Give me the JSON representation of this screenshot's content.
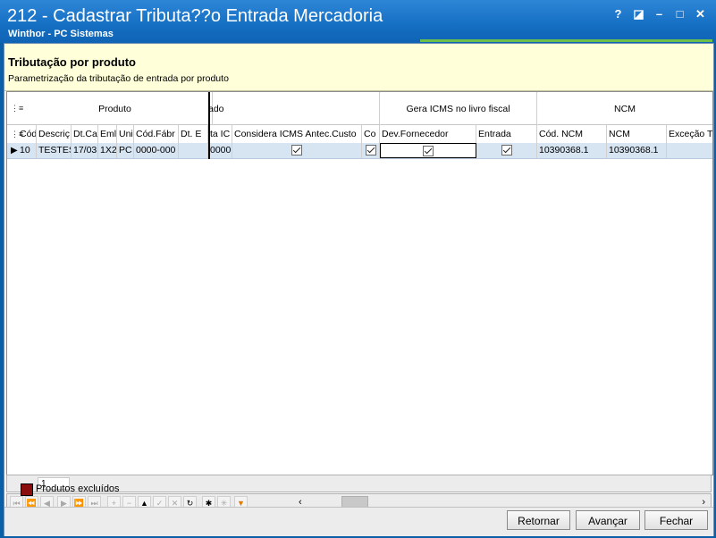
{
  "window": {
    "title": "212 - Cadastrar Tributa??o Entrada Mercadoria",
    "subtitle": "Winthor - PC Sistemas",
    "controls": [
      "?",
      "◪",
      "–",
      "□",
      "✕"
    ]
  },
  "header": {
    "title": "Tributação por produto",
    "description": "Parametrização da tributação de entrada por produto"
  },
  "grid": {
    "bands": {
      "produto": "Produto",
      "cut": "ado",
      "gera_icms": "Gera ICMS no livro fiscal",
      "ncm": "NCM"
    },
    "columns": [
      "Cód",
      "Descriç",
      "Dt.Ca",
      "Eml",
      "Uni",
      "Cód.Fábr",
      "Dt. E",
      "ta IC",
      "Considera ICMS Antec.Custo",
      "Co",
      "Dev.Fornecedor",
      "Entrada",
      "Cód. NCM",
      "NCM",
      "Exceção T"
    ],
    "row": {
      "cod": "10",
      "descricao": "TESTES",
      "dtcad": "17/03",
      "emb": "1X2",
      "unid": "PC",
      "codfab": "0000-000",
      "dte": "",
      "taic": "0000",
      "cod_ncm": "10390368.1",
      "ncm": "10390368.1",
      "excecao": ""
    }
  },
  "pager": {
    "page": "1"
  },
  "legend": {
    "label": "Produtos excluídos",
    "color": "#8a0e0e"
  },
  "footer": {
    "retornar": "Retornar",
    "avancar": "Avançar",
    "fechar": "Fechar"
  }
}
